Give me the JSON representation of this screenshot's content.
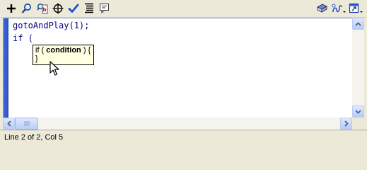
{
  "toolbar": {
    "left_buttons": [
      {
        "name": "add-statement-icon",
        "tooltip": ""
      },
      {
        "name": "find-icon",
        "tooltip": ""
      },
      {
        "name": "find-replace-icon",
        "tooltip": ""
      },
      {
        "name": "insert-target-path-icon",
        "tooltip": ""
      },
      {
        "name": "check-syntax-icon",
        "tooltip": ""
      },
      {
        "name": "auto-format-icon",
        "tooltip": ""
      },
      {
        "name": "show-code-hint-icon",
        "tooltip": ""
      }
    ],
    "right_buttons": [
      {
        "name": "reference-icon"
      },
      {
        "name": "debug-options-icon"
      },
      {
        "name": "view-options-icon"
      }
    ]
  },
  "editor": {
    "lines": [
      "gotoAndPlay(1);",
      "if ("
    ],
    "code_color": "#000080",
    "gutter_color": "#3a5fcd"
  },
  "code_hint": {
    "prefix": "if ( ",
    "param": "condition",
    "suffix": " ) {",
    "line2": "}"
  },
  "status": {
    "text": "Line 2 of 2, Col 5"
  }
}
